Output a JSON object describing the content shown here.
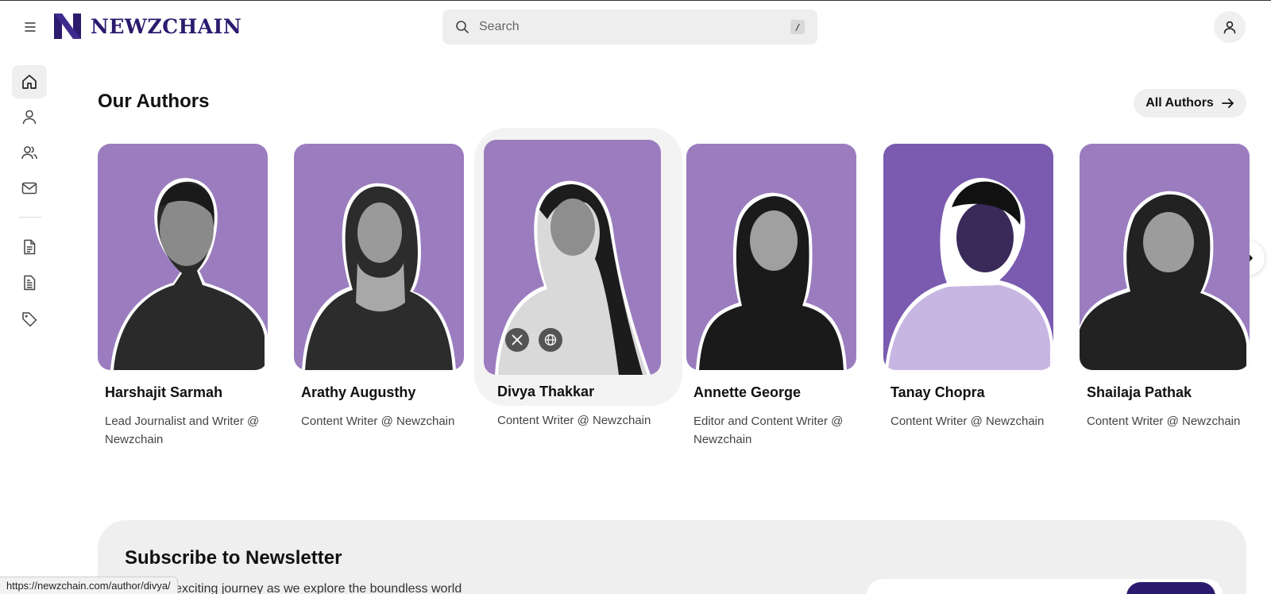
{
  "header": {
    "brand": "NEWZCHAIN",
    "search_placeholder": "Search",
    "search_shortcut": "/"
  },
  "sidebar": {
    "items": [
      {
        "icon": "home-icon",
        "active": true
      },
      {
        "icon": "user-icon",
        "active": false
      },
      {
        "icon": "users-icon",
        "active": false
      },
      {
        "icon": "mail-icon",
        "active": false
      },
      {
        "icon": "document-icon",
        "active": false
      },
      {
        "icon": "document-list-icon",
        "active": false
      },
      {
        "icon": "tag-icon",
        "active": false
      }
    ]
  },
  "authors_section": {
    "title": "Our Authors",
    "all_button": "All Authors",
    "authors": [
      {
        "name": "Harshajit Sarmah",
        "role": "Lead Journalist and Writer @ Newzchain"
      },
      {
        "name": "Arathy Augusthy",
        "role": "Content Writer @ Newzchain"
      },
      {
        "name": "Divya Thakkar",
        "role": "Content Writer @ Newzchain",
        "hovered": true
      },
      {
        "name": "Annette George",
        "role": "Editor and Content Writer @ Newzchain"
      },
      {
        "name": "Tanay Chopra",
        "role": "Content Writer @ Newzchain"
      },
      {
        "name": "Shailaja Pathak",
        "role": "Content Writer @ Newzchain"
      }
    ]
  },
  "newsletter": {
    "title": "Subscribe to Newsletter",
    "description": "Join this exciting journey as we explore the boundless world"
  },
  "status_bar": {
    "url": "https://newzchain.com/author/divya/"
  },
  "colors": {
    "brand": "#2b1a6e",
    "card_bg": "#9b7dbf",
    "card_bg_dark": "#7a5bb0"
  }
}
